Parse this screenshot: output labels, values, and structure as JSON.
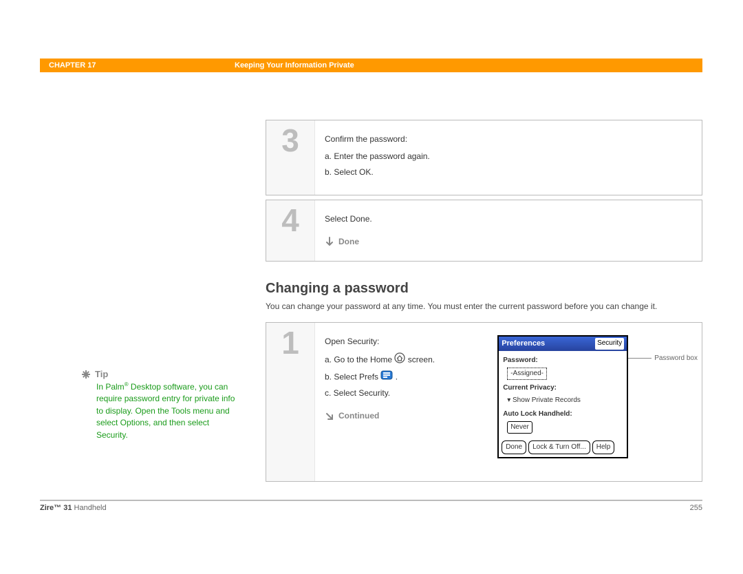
{
  "header": {
    "chapter": "CHAPTER 17",
    "section": "Keeping Your Information Private"
  },
  "steps_top": [
    {
      "num": "3",
      "lead": "Confirm the password:",
      "items": [
        "a.  Enter the password again.",
        "b.  Select OK."
      ]
    },
    {
      "num": "4",
      "lead": "Select Done.",
      "done": "Done"
    }
  ],
  "section2": {
    "title": "Changing a password",
    "desc": "You can change your password at any time. You must enter the current password before you can change it."
  },
  "tip": {
    "label": "Tip",
    "text_prefix": "In Palm",
    "text_rest": " Desktop software, you can require password entry for private info to display. Open the Tools menu and select Options, and then select Security."
  },
  "step_bottom": {
    "num": "1",
    "lead": "Open Security:",
    "a_pre": "a.  Go to the Home ",
    "a_post": " screen.",
    "b_pre": "b.  Select Prefs ",
    "b_post": " .",
    "c": "c.  Select Security.",
    "continued": "Continued"
  },
  "palm": {
    "title_left": "Preferences",
    "title_right": "Security",
    "password_lbl": "Password:",
    "password_val": "-Assigned-",
    "privacy_lbl": "Current Privacy:",
    "privacy_val": "Show Private Records",
    "autolock_lbl": "Auto Lock Handheld:",
    "autolock_val": "Never",
    "btn_done": "Done",
    "btn_lock": "Lock & Turn Off...",
    "btn_help": "Help",
    "callout": "Password box"
  },
  "footer": {
    "product_bold": "Zire™ 31",
    "product_rest": " Handheld",
    "page": "255"
  }
}
